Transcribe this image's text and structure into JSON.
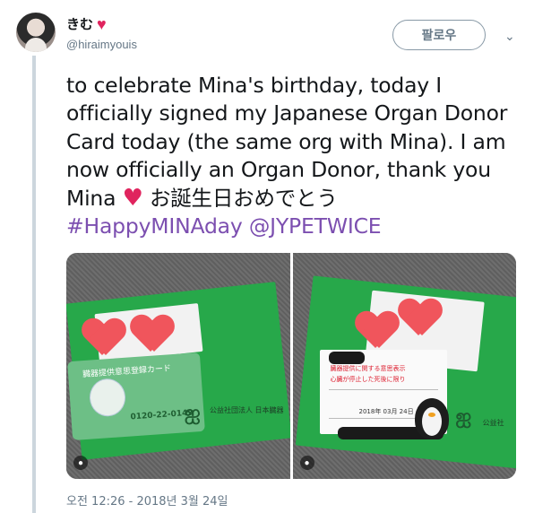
{
  "user": {
    "display_name": "きむ",
    "display_emoji": "heart-emoji",
    "handle": "@hiraimyouis"
  },
  "header": {
    "follow_label": "팔로우",
    "menu_icon": "chevron-down-icon"
  },
  "tweet": {
    "text_before_heart": "to celebrate Mina's birthday, today I officially signed my Japanese Organ Donor Card today (the same org with Mina). I am now officially an Organ Donor, thank you Mina ",
    "heart": "♥",
    "text_after_heart": " お誕生日おめでとう ",
    "hashtag": "#HappyMINAday",
    "mention": "@JYPETWICE"
  },
  "media": {
    "photo1": {
      "card_title": "臓器提供意思登録カード",
      "card_phone": "0120-22-0149",
      "org_name": "公益社団法人 日本臓器"
    },
    "photo2": {
      "org_name": "公益社",
      "date_text": "2018年 03月 24日"
    }
  },
  "timestamp": "오전 12:26 - 2018년 3월 24일",
  "colors": {
    "link": "#7c4fb0",
    "heart": "#e0245e",
    "envelope": "#27a84a"
  }
}
